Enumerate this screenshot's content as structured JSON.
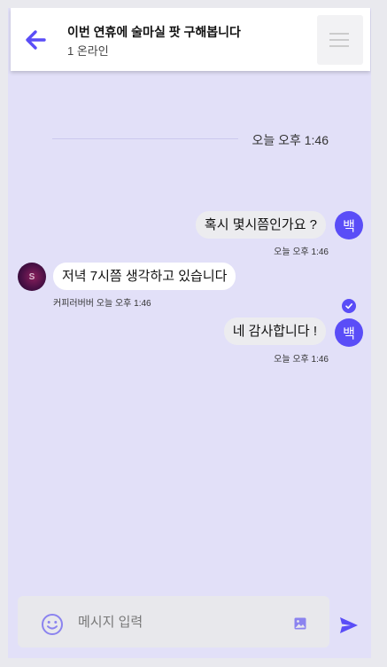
{
  "header": {
    "title": "이번 연휴에 술마실 팟 구해봅니다",
    "status": "1 온라인",
    "icons": {
      "back": "arrow-left-icon",
      "menu": "hamburger-menu-icon"
    }
  },
  "date_divider": "오늘 오후 1:46",
  "messages": [
    {
      "direction": "outgoing",
      "text": "혹시 몇시쯤인가요 ?",
      "avatar": "백",
      "time": "오늘 오후 1:46"
    },
    {
      "direction": "incoming",
      "text": "저녁 7시쯤 생각하고 있습니다",
      "avatar": "S",
      "sender": "커피러버버",
      "time": "오늘 오후 1:46"
    },
    {
      "direction": "outgoing",
      "text": "네 감사합니다 !",
      "avatar": "백",
      "time": "오늘 오후 1:46",
      "read_icon": "check-circle-icon"
    }
  ],
  "composer": {
    "placeholder": "메시지 입력",
    "icons": {
      "emoji": "smiley-face-icon",
      "image": "image-icon",
      "send": "send-icon"
    }
  },
  "colors": {
    "accent": "#5a4df7",
    "background": "#e2e0f8",
    "bubble_out": "#ececef",
    "bubble_in": "#ffffff"
  }
}
